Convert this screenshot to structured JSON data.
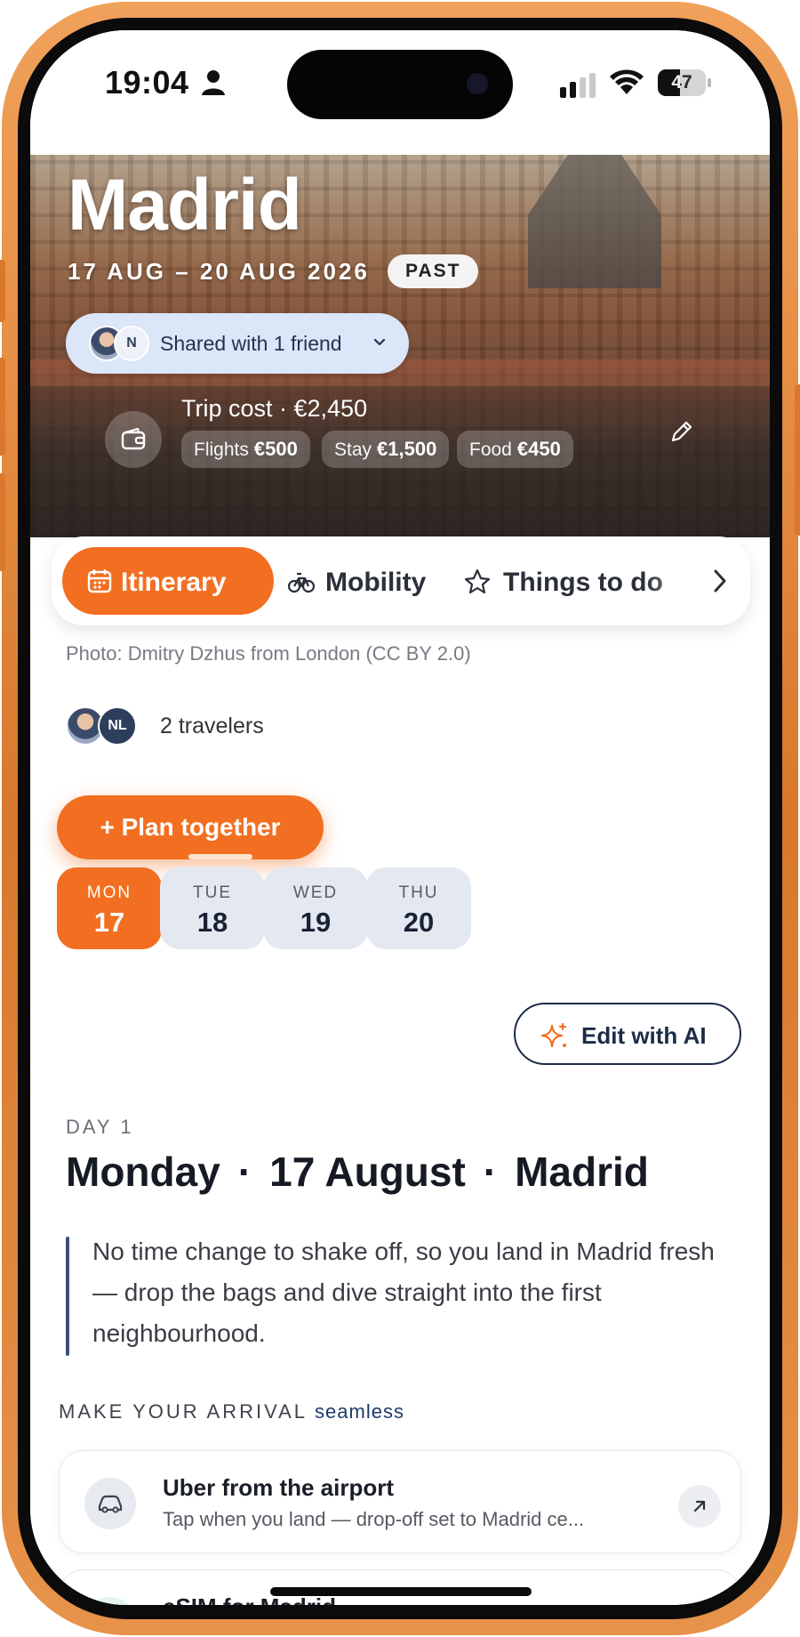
{
  "status_bar": {
    "time": "19:04",
    "battery": "47",
    "battery_level": 0.47
  },
  "trip": {
    "city": "Madrid",
    "dates": "17 AUG – 20 AUG 2026",
    "status_badge": "PAST",
    "shared_label": "Shared with 1 friend",
    "shared_avatar_initial": "N",
    "cost_title": "Trip cost · €2,450",
    "cost_items": [
      {
        "label": "Flights",
        "value": "€500"
      },
      {
        "label": "Stay",
        "value": "€1,500"
      },
      {
        "label": "Food",
        "value": "€450"
      }
    ]
  },
  "tabs": [
    {
      "label": "Itinerary",
      "icon": "calendar-icon",
      "active": true
    },
    {
      "label": "Mobility",
      "icon": "bike-icon",
      "active": false
    },
    {
      "label": "Things to do",
      "icon": "star-icon",
      "active": false
    }
  ],
  "photo_credit": "Photo: Dmitry Dzhus from London (CC BY 2.0)",
  "travelers": {
    "avatar_initials": "NL",
    "label": "2 travelers"
  },
  "plan_button": "+ Plan together",
  "days": [
    {
      "weekday": "MON",
      "date": "17",
      "active": true
    },
    {
      "weekday": "TUE",
      "date": "18",
      "active": false
    },
    {
      "weekday": "WED",
      "date": "19",
      "active": false
    },
    {
      "weekday": "THU",
      "date": "20",
      "active": false
    }
  ],
  "edit_ai_label": "Edit with AI",
  "day_detail": {
    "kicker": "DAY 1",
    "weekday": "Monday",
    "date": "17 August",
    "city": "Madrid",
    "separator": "·",
    "intro": "No time change to shake off, so you land in Madrid fresh — drop the bags and dive straight into the first neighbourhood."
  },
  "arrival": {
    "kicker": "MAKE YOUR ARRIVAL",
    "kicker_highlight": "seamless",
    "cards": [
      {
        "title": "Uber from the airport",
        "subtitle": "Tap when you land — drop-off set to Madrid ce...",
        "icon": "car-icon"
      },
      {
        "title": "eSIM for Madrid",
        "icon": "sim-icon"
      }
    ]
  },
  "colors": {
    "accent": "#f26f21",
    "navy": "#1c2b47",
    "pill": "#dbe6f8",
    "day_inactive": "#e4e9f1"
  }
}
